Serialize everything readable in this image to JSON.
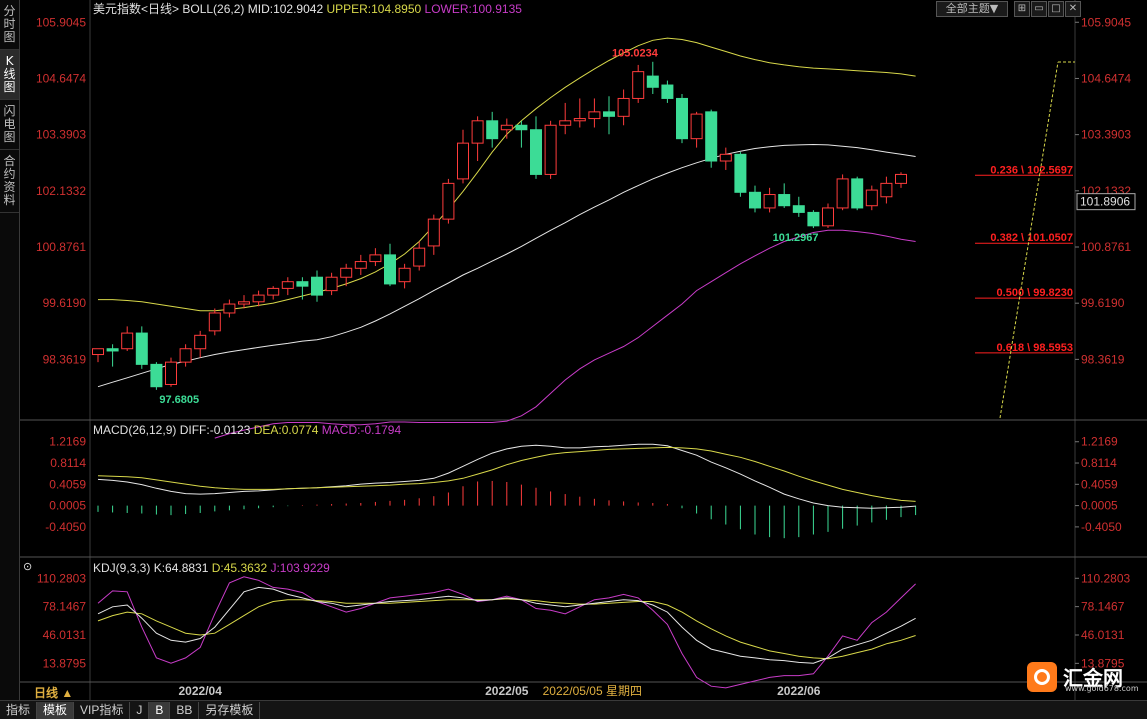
{
  "sidebar": {
    "items": [
      {
        "label": "分时图"
      },
      {
        "label": "K线图"
      },
      {
        "label": "闪电图"
      },
      {
        "label": "合约资料"
      }
    ]
  },
  "header": {
    "theme_button": "全部主题▼"
  },
  "bottom_tabs": [
    "指标",
    "模板",
    "VIP指标",
    "J",
    "B",
    "BB",
    "另存模板"
  ],
  "period_label": "日线 ▲",
  "colors": {
    "up": "#ff3c3c",
    "down": "#3cdc96",
    "mid": "#e6e6e6",
    "upper": "#d8d84a",
    "lower": "#c83cc8",
    "diff": "#e6e6e6",
    "dea": "#d8d84a",
    "macd": "#c83cc8",
    "axis_text": "#d03030",
    "fib": "#ff2020"
  },
  "chart_data": [
    {
      "type": "candlestick",
      "title_segments": [
        {
          "text": "美元指数<日线>",
          "color": "#e0e0e0"
        },
        {
          "text": "BOLL(26,2)",
          "color": "#e0e0e0"
        },
        {
          "text": "MID:102.9042",
          "color": "#e6e6e6"
        },
        {
          "text": "UPPER:104.8950",
          "color": "#d8d84a"
        },
        {
          "text": "LOWER:100.9135",
          "color": "#c83cc8"
        }
      ],
      "y_ticks": [
        "105.9045",
        "104.6474",
        "103.3903",
        "102.1332",
        "100.8761",
        "99.6190",
        "98.3619"
      ],
      "ylim": [
        97.05,
        106.0
      ],
      "current_price": "101.8906",
      "x_labels": [
        {
          "text": "2022/04",
          "index": 7
        },
        {
          "text": "2022/05",
          "index": 28
        },
        {
          "text": "2022/06",
          "index": 48
        }
      ],
      "cursor_label": "2022/05/05 星期四",
      "cursor_index": 31,
      "annotations": [
        {
          "text": "105.0234",
          "index": 35,
          "value": 105.0234,
          "color": "#ff3c3c"
        },
        {
          "text": "97.6805",
          "index": 4,
          "value": 97.6805,
          "color": "#3cdc96"
        },
        {
          "text": "101.2967",
          "index": 46,
          "value": 101.2967,
          "color": "#3cdc96"
        }
      ],
      "fibonacci": [
        {
          "label": "0.236 \\ 102.5697",
          "value": 102.5697
        },
        {
          "label": "0.382 \\ 101.0507",
          "value": 101.0507
        },
        {
          "label": "0.500 \\ 99.8230",
          "value": 99.823
        },
        {
          "label": "0.618 \\ 98.5953",
          "value": 98.5953
        }
      ],
      "candles": [
        {
          "o": 98.47,
          "h": 98.6,
          "l": 98.3,
          "c": 98.6
        },
        {
          "o": 98.6,
          "h": 98.7,
          "l": 98.2,
          "c": 98.55
        },
        {
          "o": 98.6,
          "h": 99.1,
          "l": 98.55,
          "c": 98.95
        },
        {
          "o": 98.95,
          "h": 99.1,
          "l": 98.15,
          "c": 98.25
        },
        {
          "o": 98.25,
          "h": 98.3,
          "l": 97.68,
          "c": 97.75
        },
        {
          "o": 97.8,
          "h": 98.4,
          "l": 97.75,
          "c": 98.3
        },
        {
          "o": 98.3,
          "h": 98.7,
          "l": 98.2,
          "c": 98.6
        },
        {
          "o": 98.6,
          "h": 99.0,
          "l": 98.4,
          "c": 98.9
        },
        {
          "o": 99.0,
          "h": 99.5,
          "l": 98.9,
          "c": 99.4
        },
        {
          "o": 99.4,
          "h": 99.7,
          "l": 99.3,
          "c": 99.6
        },
        {
          "o": 99.6,
          "h": 99.8,
          "l": 99.5,
          "c": 99.65
        },
        {
          "o": 99.65,
          "h": 99.9,
          "l": 99.55,
          "c": 99.8
        },
        {
          "o": 99.8,
          "h": 100.0,
          "l": 99.7,
          "c": 99.95
        },
        {
          "o": 99.95,
          "h": 100.2,
          "l": 99.8,
          "c": 100.1
        },
        {
          "o": 100.1,
          "h": 100.2,
          "l": 99.7,
          "c": 100.0
        },
        {
          "o": 100.2,
          "h": 100.35,
          "l": 99.65,
          "c": 99.8
        },
        {
          "o": 99.9,
          "h": 100.3,
          "l": 99.8,
          "c": 100.2
        },
        {
          "o": 100.2,
          "h": 100.5,
          "l": 100.0,
          "c": 100.4
        },
        {
          "o": 100.4,
          "h": 100.7,
          "l": 100.25,
          "c": 100.55
        },
        {
          "o": 100.55,
          "h": 100.85,
          "l": 100.45,
          "c": 100.7
        },
        {
          "o": 100.7,
          "h": 100.95,
          "l": 100.0,
          "c": 100.05
        },
        {
          "o": 100.1,
          "h": 100.5,
          "l": 99.95,
          "c": 100.4
        },
        {
          "o": 100.45,
          "h": 101.0,
          "l": 100.35,
          "c": 100.85
        },
        {
          "o": 100.9,
          "h": 101.6,
          "l": 100.7,
          "c": 101.5
        },
        {
          "o": 101.5,
          "h": 102.4,
          "l": 101.4,
          "c": 102.3
        },
        {
          "o": 102.4,
          "h": 103.5,
          "l": 102.3,
          "c": 103.2
        },
        {
          "o": 103.2,
          "h": 103.8,
          "l": 102.8,
          "c": 103.7
        },
        {
          "o": 103.7,
          "h": 103.9,
          "l": 103.1,
          "c": 103.3
        },
        {
          "o": 103.5,
          "h": 103.75,
          "l": 103.3,
          "c": 103.6
        },
        {
          "o": 103.6,
          "h": 103.7,
          "l": 103.1,
          "c": 103.5
        },
        {
          "o": 103.5,
          "h": 103.8,
          "l": 102.4,
          "c": 102.5
        },
        {
          "o": 102.5,
          "h": 103.7,
          "l": 102.4,
          "c": 103.6
        },
        {
          "o": 103.6,
          "h": 104.1,
          "l": 103.4,
          "c": 103.7
        },
        {
          "o": 103.7,
          "h": 104.2,
          "l": 103.55,
          "c": 103.75
        },
        {
          "o": 103.75,
          "h": 104.2,
          "l": 103.55,
          "c": 103.9
        },
        {
          "o": 103.9,
          "h": 104.25,
          "l": 103.4,
          "c": 103.8
        },
        {
          "o": 103.8,
          "h": 104.4,
          "l": 103.6,
          "c": 104.2
        },
        {
          "o": 104.2,
          "h": 104.95,
          "l": 104.1,
          "c": 104.8
        },
        {
          "o": 104.7,
          "h": 105.02,
          "l": 104.3,
          "c": 104.45
        },
        {
          "o": 104.5,
          "h": 104.6,
          "l": 104.1,
          "c": 104.2
        },
        {
          "o": 104.2,
          "h": 104.3,
          "l": 103.2,
          "c": 103.3
        },
        {
          "o": 103.3,
          "h": 103.9,
          "l": 103.1,
          "c": 103.85
        },
        {
          "o": 103.9,
          "h": 103.95,
          "l": 102.65,
          "c": 102.8
        },
        {
          "o": 102.8,
          "h": 103.1,
          "l": 102.6,
          "c": 102.95
        },
        {
          "o": 102.95,
          "h": 103.0,
          "l": 102.0,
          "c": 102.1
        },
        {
          "o": 102.1,
          "h": 102.25,
          "l": 101.65,
          "c": 101.75
        },
        {
          "o": 101.75,
          "h": 102.2,
          "l": 101.65,
          "c": 102.05
        },
        {
          "o": 102.05,
          "h": 102.3,
          "l": 101.75,
          "c": 101.8
        },
        {
          "o": 101.8,
          "h": 102.0,
          "l": 101.55,
          "c": 101.65
        },
        {
          "o": 101.65,
          "h": 101.7,
          "l": 101.3,
          "c": 101.35
        },
        {
          "o": 101.35,
          "h": 101.85,
          "l": 101.3,
          "c": 101.75
        },
        {
          "o": 101.75,
          "h": 102.5,
          "l": 101.7,
          "c": 102.4
        },
        {
          "o": 102.4,
          "h": 102.45,
          "l": 101.7,
          "c": 101.75
        },
        {
          "o": 101.8,
          "h": 102.25,
          "l": 101.7,
          "c": 102.15
        },
        {
          "o": 102.0,
          "h": 102.45,
          "l": 101.85,
          "c": 102.3
        },
        {
          "o": 102.3,
          "h": 102.55,
          "l": 102.2,
          "c": 102.5
        }
      ],
      "series": [
        {
          "name": "MID",
          "color": "#e6e6e6",
          "values": [
            97.75,
            97.85,
            97.95,
            98.05,
            98.15,
            98.25,
            98.32,
            98.4,
            98.47,
            98.53,
            98.58,
            98.63,
            98.68,
            98.72,
            98.77,
            98.8,
            98.87,
            98.97,
            99.08,
            99.22,
            99.38,
            99.55,
            99.72,
            99.9,
            100.07,
            100.25,
            100.4,
            100.56,
            100.72,
            100.89,
            101.07,
            101.25,
            101.42,
            101.6,
            101.77,
            101.93,
            102.1,
            102.25,
            102.4,
            102.53,
            102.65,
            102.76,
            102.86,
            102.95,
            103.02,
            103.08,
            103.12,
            103.15,
            103.16,
            103.17,
            103.16,
            103.13,
            103.1,
            103.05,
            103.0,
            102.95,
            102.9
          ]
        },
        {
          "name": "UPPER",
          "color": "#d8d84a",
          "values": [
            99.7,
            99.7,
            99.68,
            99.65,
            99.6,
            99.55,
            99.5,
            99.45,
            99.45,
            99.48,
            99.52,
            99.57,
            99.62,
            99.7,
            99.78,
            99.86,
            99.95,
            100.05,
            100.17,
            100.32,
            100.5,
            100.72,
            101.0,
            101.35,
            101.72,
            102.12,
            102.55,
            103.0,
            103.4,
            103.7,
            103.97,
            104.22,
            104.45,
            104.66,
            104.86,
            105.05,
            105.22,
            105.38,
            105.5,
            105.55,
            105.52,
            105.45,
            105.35,
            105.25,
            105.15,
            105.07,
            105.0,
            104.95,
            104.91,
            104.88,
            104.86,
            104.84,
            104.82,
            104.8,
            104.78,
            104.75,
            104.7
          ]
        },
        {
          "name": "LOWER",
          "color": "#c83cc8",
          "values": [
            null,
            null,
            null,
            null,
            null,
            null,
            null,
            null,
            96.6,
            96.7,
            96.78,
            96.85,
            96.92,
            96.95,
            96.95,
            96.95,
            96.92,
            96.9,
            96.9,
            96.92,
            96.96,
            96.96,
            96.95,
            96.95,
            96.95,
            96.95,
            96.95,
            96.95,
            96.98,
            97.1,
            97.3,
            97.6,
            97.9,
            98.15,
            98.35,
            98.5,
            98.65,
            98.85,
            99.1,
            99.35,
            99.6,
            99.9,
            100.1,
            100.3,
            100.5,
            100.68,
            100.85,
            101.0,
            101.1,
            101.2,
            101.25,
            101.25,
            101.22,
            101.18,
            101.12,
            101.05,
            101.0
          ]
        }
      ]
    },
    {
      "type": "line",
      "title_segments": [
        {
          "text": "MACD(26,12,9)",
          "color": "#e0e0e0"
        },
        {
          "text": "DIFF:-0.0123",
          "color": "#e6e6e6"
        },
        {
          "text": "DEA:0.0774",
          "color": "#d8d84a"
        },
        {
          "text": "MACD:-0.1794",
          "color": "#c83cc8"
        }
      ],
      "y_ticks": [
        "1.2169",
        "0.8114",
        "0.4059",
        "0.0005",
        "-0.4050"
      ],
      "ylim": [
        -0.75,
        1.25
      ],
      "series": [
        {
          "name": "DIFF",
          "color": "#e6e6e6",
          "values": [
            0.5,
            0.48,
            0.45,
            0.4,
            0.33,
            0.27,
            0.23,
            0.22,
            0.23,
            0.25,
            0.27,
            0.28,
            0.3,
            0.32,
            0.33,
            0.34,
            0.36,
            0.38,
            0.41,
            0.43,
            0.44,
            0.46,
            0.48,
            0.52,
            0.62,
            0.75,
            0.88,
            1.0,
            1.08,
            1.13,
            1.15,
            1.13,
            1.1,
            1.1,
            1.12,
            1.13,
            1.15,
            1.17,
            1.17,
            1.14,
            1.05,
            0.96,
            0.83,
            0.72,
            0.6,
            0.47,
            0.35,
            0.22,
            0.13,
            0.05,
            0.0,
            -0.03,
            -0.04,
            -0.05,
            -0.04,
            -0.03,
            -0.01
          ]
        },
        {
          "name": "DEA",
          "color": "#d8d84a",
          "values": [
            0.57,
            0.56,
            0.55,
            0.53,
            0.49,
            0.45,
            0.41,
            0.37,
            0.34,
            0.32,
            0.31,
            0.31,
            0.31,
            0.32,
            0.33,
            0.34,
            0.35,
            0.36,
            0.37,
            0.38,
            0.39,
            0.41,
            0.42,
            0.44,
            0.47,
            0.52,
            0.6,
            0.68,
            0.78,
            0.86,
            0.92,
            0.98,
            1.01,
            1.03,
            1.05,
            1.07,
            1.08,
            1.09,
            1.1,
            1.11,
            1.1,
            1.08,
            1.04,
            0.98,
            0.92,
            0.84,
            0.75,
            0.66,
            0.56,
            0.47,
            0.39,
            0.31,
            0.25,
            0.19,
            0.14,
            0.1,
            0.08
          ]
        },
        {
          "name": "MACD",
          "color": "#c83cc8",
          "values": [
            -0.12,
            -0.13,
            -0.14,
            -0.15,
            -0.17,
            -0.18,
            -0.16,
            -0.14,
            -0.11,
            -0.09,
            -0.07,
            -0.05,
            -0.03,
            -0.01,
            0.01,
            0.02,
            0.03,
            0.04,
            0.05,
            0.07,
            0.09,
            0.11,
            0.14,
            0.18,
            0.25,
            0.37,
            0.46,
            0.47,
            0.45,
            0.4,
            0.34,
            0.27,
            0.22,
            0.17,
            0.13,
            0.1,
            0.08,
            0.06,
            0.05,
            0.03,
            -0.05,
            -0.15,
            -0.26,
            -0.36,
            -0.45,
            -0.55,
            -0.6,
            -0.62,
            -0.6,
            -0.55,
            -0.5,
            -0.44,
            -0.38,
            -0.32,
            -0.27,
            -0.22,
            -0.18
          ]
        }
      ]
    },
    {
      "type": "line",
      "title_segments": [
        {
          "text": "KDJ(9,3,3)",
          "color": "#e0e0e0"
        },
        {
          "text": "K:64.8831",
          "color": "#e6e6e6"
        },
        {
          "text": "D:45.3632",
          "color": "#d8d84a"
        },
        {
          "text": "J:103.9229",
          "color": "#c83cc8"
        }
      ],
      "y_ticks": [
        "110.2803",
        "78.1467",
        "46.0131",
        "13.8795"
      ],
      "ylim": [
        -5,
        114
      ],
      "series": [
        {
          "name": "K",
          "color": "#e6e6e6",
          "values": [
            70,
            78,
            80,
            65,
            48,
            40,
            38,
            42,
            55,
            75,
            95,
            100,
            98,
            92,
            88,
            84,
            82,
            78,
            80,
            82,
            84,
            85,
            86,
            88,
            90,
            88,
            85,
            86,
            88,
            86,
            82,
            80,
            78,
            80,
            82,
            84,
            86,
            85,
            80,
            72,
            55,
            40,
            30,
            26,
            22,
            20,
            18,
            17,
            15,
            14,
            20,
            30,
            35,
            40,
            48,
            56,
            64.9
          ]
        },
        {
          "name": "D",
          "color": "#d8d84a",
          "values": [
            62,
            68,
            72,
            70,
            62,
            55,
            48,
            46,
            48,
            58,
            68,
            78,
            84,
            86,
            86,
            85,
            84,
            82,
            82,
            82,
            82,
            83,
            84,
            85,
            86,
            86,
            86,
            86,
            87,
            86,
            85,
            83,
            82,
            81,
            81,
            82,
            83,
            84,
            84,
            80,
            72,
            62,
            53,
            45,
            38,
            33,
            28,
            25,
            22,
            20,
            19,
            22,
            26,
            30,
            36,
            40,
            45.4
          ]
        },
        {
          "name": "J",
          "color": "#c83cc8",
          "values": [
            82,
            96,
            95,
            55,
            20,
            14,
            20,
            32,
            70,
            105,
            112,
            108,
            100,
            98,
            94,
            84,
            78,
            72,
            76,
            82,
            88,
            90,
            92,
            94,
            98,
            92,
            84,
            86,
            90,
            86,
            76,
            74,
            70,
            78,
            86,
            88,
            92,
            88,
            74,
            58,
            25,
            -2,
            -12,
            -14,
            -10,
            -6,
            -2,
            0,
            0,
            2,
            22,
            45,
            40,
            60,
            72,
            88,
            103.9
          ]
        }
      ]
    }
  ]
}
